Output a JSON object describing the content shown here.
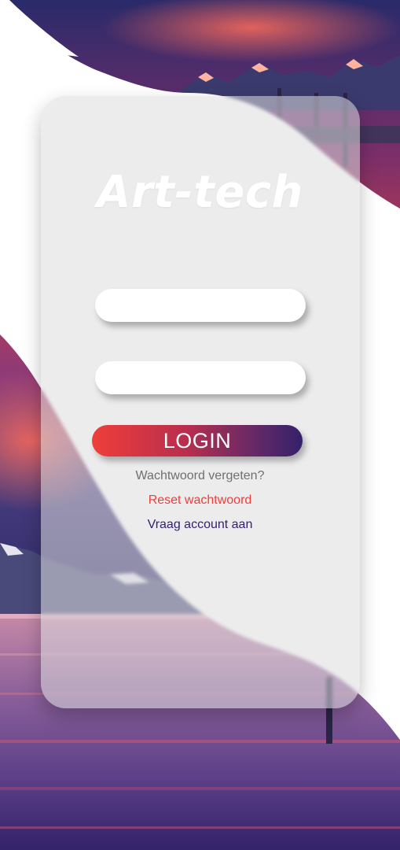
{
  "app": {
    "title": "Art-tech"
  },
  "form": {
    "username_value": "",
    "password_value": "",
    "login_label": "LOGIN"
  },
  "links": {
    "forgot": "Wachtwoord vergeten?",
    "reset": "Reset wachtwoord",
    "request_account": "Vraag account aan"
  },
  "colors": {
    "accent_red": "#ef3e3a",
    "accent_purple": "#34216a",
    "muted_text": "#6f6f6f",
    "card_fill": "#dcdcde"
  }
}
